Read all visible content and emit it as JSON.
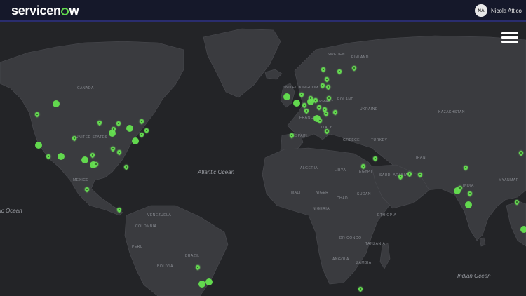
{
  "header": {
    "logo_pre": "servicen",
    "logo_post": "w",
    "user_initials": "NA",
    "user_name": "Nicola Attico"
  },
  "map": {
    "land_color": "#3a3b3f",
    "sea_color": "#232427",
    "marker_color": "#62d84e",
    "country_labels": {
      "canada": "CANADA",
      "united_states": "UNITED STATES",
      "mexico": "MEXICO",
      "venezuela": "VENEZUELA",
      "colombia": "COLOMBIA",
      "peru": "PERU",
      "bolivia": "BOLIVIA",
      "brazil": "BRAZIL",
      "sweden": "SWEDEN",
      "finland": "FINLAND",
      "united_kingdom": "UNITED KINGDOM",
      "germany": "GERMANY",
      "poland": "POLAND",
      "ukraine": "UKRAINE",
      "france": "FRANCE",
      "spain": "SPAIN",
      "italy": "ITALY",
      "greece": "GREECE",
      "turkey": "TURKEY",
      "kazakhstan": "KAZAKHSTAN",
      "iran": "IRAN",
      "algeria": "ALGERIA",
      "libya": "LIBYA",
      "egypt": "EGYPT",
      "saudi_arabia": "SAUDI ARABIA",
      "mali": "MALI",
      "niger": "NIGER",
      "chad": "CHAD",
      "sudan": "SUDAN",
      "nigeria": "NIGERIA",
      "ethiopia": "ETHIOPIA",
      "dr_congo": "DR CONGO",
      "tanzania": "TANZANIA",
      "angola": "ANGOLA",
      "zambia": "ZAMBIA",
      "india": "INDIA",
      "myanmar": "MYANMAR"
    },
    "ocean_labels": {
      "atlantic": "Atlantic Ocean",
      "pacific": "ic Ocean",
      "indian": "Indian Ocean"
    }
  }
}
